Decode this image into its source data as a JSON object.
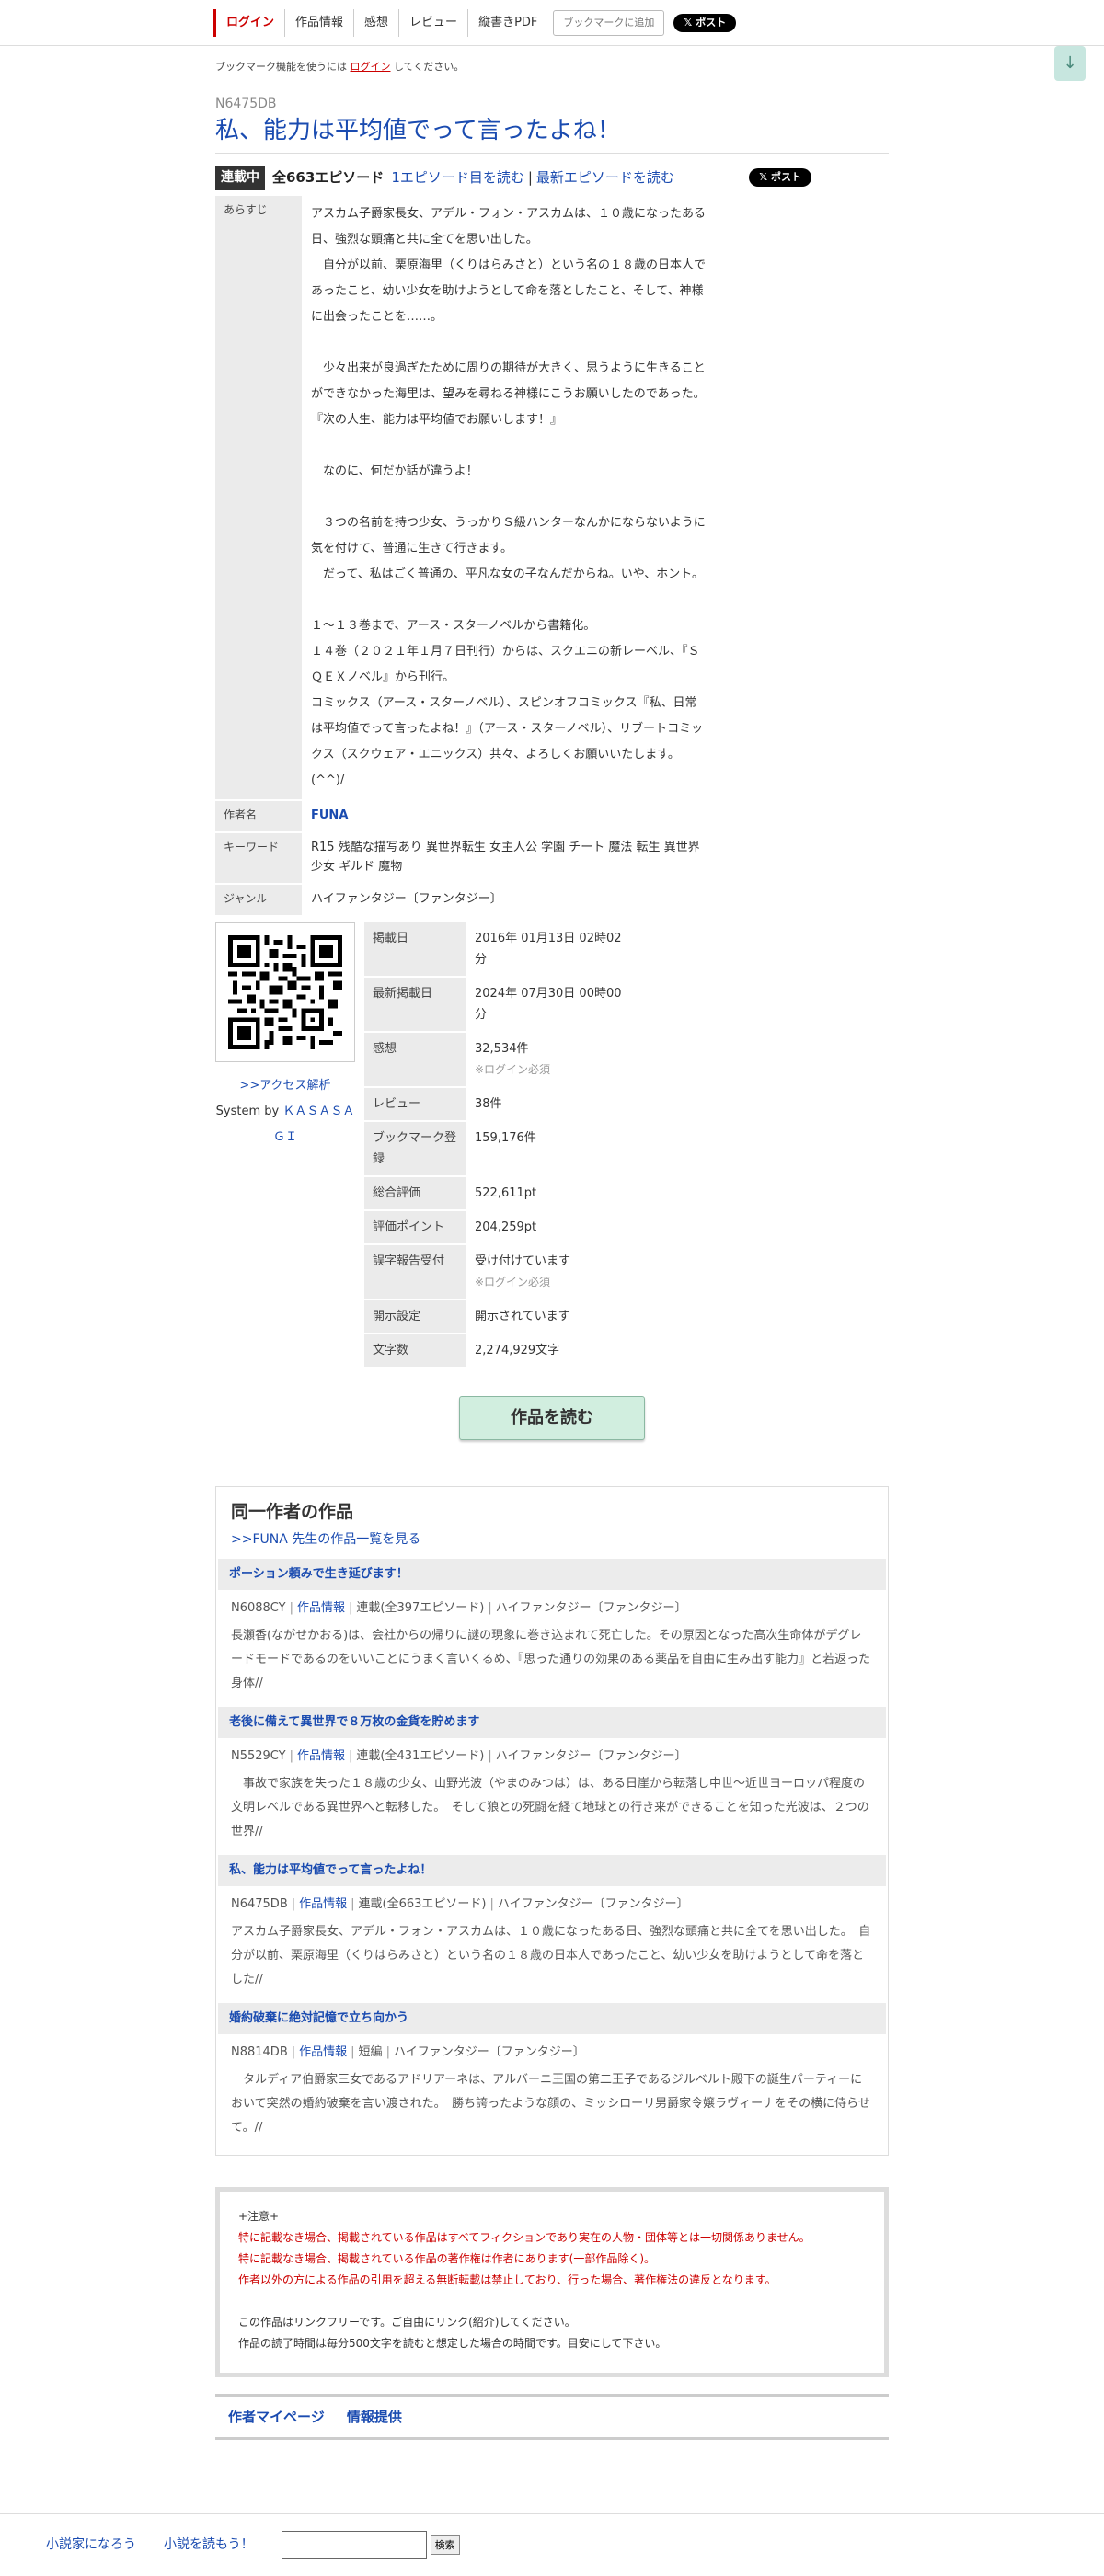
{
  "nav": {
    "login": "ログイン",
    "work_info": "作品情報",
    "impressions": "感想",
    "review": "レビュー",
    "vertical_pdf": "縦書きPDF",
    "add_bookmark": "ブックマークに追加",
    "xpost": "ポスト"
  },
  "login_note": {
    "prefix": "ブックマーク機能を使うには",
    "link": "ログイン",
    "suffix": "してください。"
  },
  "novel": {
    "ncode": "N6475DB",
    "title": "私、能力は平均値でって言ったよね！",
    "status_badge": "連載中",
    "episode_count": "全663エピソード",
    "first_ep_link": "1エピソード目を読む",
    "separator": "|",
    "latest_ep_link": "最新エピソードを読む"
  },
  "info": {
    "synopsis_label": "あらすじ",
    "synopsis": "アスカム子爵家長女、アデル・フォン・アスカムは、１０歳になったある日、強烈な頭痛と共に全てを思い出した。\n　自分が以前、栗原海里（くりはらみさと）という名の１８歳の日本人であったこと、幼い少女を助けようとして命を落としたこと、そして、神様に出会ったことを……。\n\n　少々出来が良過ぎたために周りの期待が大きく、思うように生きることができなかった海里は、望みを尋ねる神様にこうお願いしたのであった。\n『次の人生、能力は平均値でお願いします！』\n\n　なのに、何だか話が違うよ！\n\n　３つの名前を持つ少女、うっかりＳ級ハンターなんかにならないように気を付けて、普通に生きて行きます。\n　だって、私はごく普通の、平凡な女の子なんだからね。いや、ホント。\n\n１～１３巻まで、アース・スターノベルから書籍化。\n１４巻（２０２１年１月７日刊行）からは、スクエニの新レーベル、『ＳＱＥＸノベル』から刊行。\nコミックス（アース・スターノベル）、スピンオフコミックス『私、日常は平均値でって言ったよね！』（アース・スターノベル）、リブートコミックス（スクウェア・エニックス）共々、よろしくお願いいたします。(^^)/",
    "author_label": "作者名",
    "author": "FUNA",
    "keywords_label": "キーワード",
    "keywords": "R15 残酷な描写あり 異世界転生 女主人公 学園 チート 魔法 転生 異世界 少女 ギルド 魔物",
    "genre_label": "ジャンル",
    "genre": "ハイファンタジー〔ファンタジー〕"
  },
  "qr": {
    "access_link": ">>アクセス解析",
    "system_by": "System by",
    "kasasagi": "ＫＡＳＡＳＡＧＩ"
  },
  "stats": [
    {
      "label": "掲載日",
      "value": "2016年 01月13日 02時02分",
      "note": ""
    },
    {
      "label": "最新掲載日",
      "value": "2024年 07月30日 00時00分",
      "note": ""
    },
    {
      "label": "感想",
      "value": "32,534件",
      "note": "※ログイン必須"
    },
    {
      "label": "レビュー",
      "value": "38件",
      "note": ""
    },
    {
      "label": "ブックマーク登録",
      "value": "159,176件",
      "note": ""
    },
    {
      "label": "総合評価",
      "value": "522,611pt",
      "note": ""
    },
    {
      "label": "評価ポイント",
      "value": "204,259pt",
      "note": ""
    },
    {
      "label": "誤字報告受付",
      "value": "受け付けています",
      "note": "※ログイン必須"
    },
    {
      "label": "開示設定",
      "value": "開示されています",
      "note": ""
    },
    {
      "label": "文字数",
      "value": "2,274,929文字",
      "note": ""
    }
  ],
  "read_button": "作品を読む",
  "same_author": {
    "heading": "同一作者の作品",
    "all_works_link": ">>FUNA 先生の作品一覧を見る",
    "info_label": "作品情報",
    "works": [
      {
        "title": "ポーション頼みで生き延びます！",
        "ncode": "N6088CY",
        "kind": "連載(全397エピソード)",
        "genre": "ハイファンタジー〔ファンタジー〕",
        "summary": "長瀬香(ながせかおる)は、会社からの帰りに謎の現象に巻き込まれて死亡した。その原因となった高次生命体がデグレードモードであるのをいいことにうまく言いくるめ、『思った通りの効果のある薬品を自由に生み出す能力』と若返った身体//"
      },
      {
        "title": "老後に備えて異世界で８万枚の金貨を貯めます",
        "ncode": "N5529CY",
        "kind": "連載(全431エピソード)",
        "genre": "ハイファンタジー〔ファンタジー〕",
        "summary": "　事故で家族を失った１８歳の少女、山野光波（やまのみつは）は、ある日崖から転落し中世～近世ヨーロッパ程度の文明レベルである異世界へと転移した。　そして狼との死闘を経て地球との行き来ができることを知った光波は、２つの世界//"
      },
      {
        "title": "私、能力は平均値でって言ったよね！",
        "ncode": "N6475DB",
        "kind": "連載(全663エピソード)",
        "genre": "ハイファンタジー〔ファンタジー〕",
        "summary": "アスカム子爵家長女、アデル・フォン・アスカムは、１０歳になったある日、強烈な頭痛と共に全てを思い出した。　自分が以前、栗原海里（くりはらみさと）という名の１８歳の日本人であったこと、幼い少女を助けようとして命を落とした//"
      },
      {
        "title": "婚約破棄に絶対記憶で立ち向かう",
        "ncode": "N8814DB",
        "kind": "短編",
        "genre": "ハイファンタジー〔ファンタジー〕",
        "summary": "　タルディア伯爵家三女であるアドリアーネは、アルバーニ王国の第二王子であるジルベルト殿下の誕生パーティーにおいて突然の婚約破棄を言い渡された。　勝ち誇ったような顔の、ミッシローリ男爵家令嬢ラヴィーナをその横に侍らせて。//"
      }
    ]
  },
  "notice": {
    "head": "+注意+",
    "red1": "特に記載なき場合、掲載されている作品はすべてフィクションであり実在の人物・団体等とは一切関係ありません。",
    "red2": "特に記載なき場合、掲載されている作品の著作権は作者にあります(一部作品除く)。",
    "red3": "作者以外の方による作品の引用を超える無断転載は禁止しており、行った場合、著作権法の違反となります。",
    "gray1": "この作品はリンクフリーです。ご自由にリンク(紹介)してください。",
    "gray2": "作品の読了時間は毎分500文字を読むと想定した場合の時間です。目安にして下さい。"
  },
  "footer_links": {
    "mypage": "作者マイページ",
    "info": "情報提供"
  },
  "site_footer": {
    "naro": "小説家になろう",
    "yomou": "小説を読もう！",
    "search_button": "検索"
  }
}
